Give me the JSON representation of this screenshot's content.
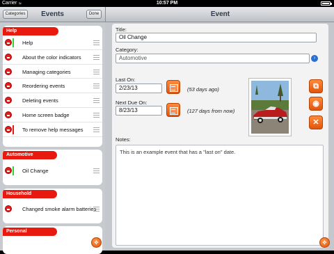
{
  "status": {
    "carrier": "Carrier",
    "time": "10:57 PM"
  },
  "left": {
    "categories_btn": "Categories",
    "title": "Events",
    "done_btn": "Done",
    "groups": [
      {
        "name": "Help",
        "items": [
          "Help",
          "About the color indicators",
          "Managing categories",
          "Reordering events",
          "Deleting events",
          "Home screen badge",
          "To remove help messages"
        ]
      },
      {
        "name": "Automotive",
        "items": [
          "Oil Change"
        ]
      },
      {
        "name": "Household",
        "items": [
          "Changed smoke alarm batteries"
        ]
      },
      {
        "name": "Personal",
        "items": []
      }
    ]
  },
  "right": {
    "title": "Event",
    "title_label": "Title:",
    "title_value": "Oil Change",
    "category_label": "Category:",
    "category_value": "Automotive",
    "last_on_label": "Last On:",
    "last_on_value": "2/23/13",
    "last_on_note": "(53 days ago)",
    "next_due_label": "Next Due On:",
    "next_due_value": "8/23/13",
    "next_due_note": "(127 days from now)",
    "notes_label": "Notes:",
    "notes_value": "This is an example event that has a \"last on\" date."
  },
  "colors": {
    "accent": "#e8190f",
    "orange": "#e0540d",
    "blue": "#2a6fd1"
  }
}
